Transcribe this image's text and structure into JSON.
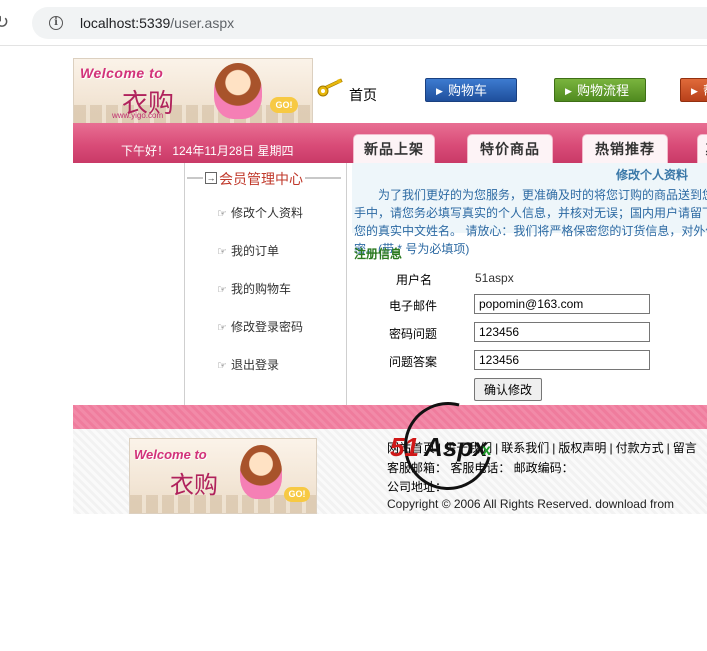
{
  "browser": {
    "url_host": "localhost:5339",
    "url_path": "/user.aspx"
  },
  "header": {
    "logo_welcome": "Welcome to",
    "logo_brand": "衣购",
    "logo_url": "www.yigo.com",
    "logo_go": "GO!",
    "home_label": "首页",
    "nav": {
      "cart": "购物车",
      "flow": "购物流程",
      "more": "帮"
    },
    "greeting": "下午好！ 124年11月28日 星期四",
    "tabs": [
      "新品上架",
      "特价商品",
      "热销推荐",
      "其"
    ]
  },
  "sidebar": {
    "title": "会员管理中心",
    "items": [
      "修改个人资料",
      "我的订单",
      "我的购物车",
      "修改登录密码",
      "退出登录"
    ]
  },
  "main": {
    "heading": "修改个人资料",
    "notice": "为了我们更好的为您服务，更准确及时的将您订购的商品送到您手中，请您务必填写真实的个人信息，并核对无误；国内用户请留下您的真实中文姓名。 请放心：我们将严格保密您的订货信息，对外保密。(带 * 号为必填项)",
    "reg_title": "注册信息",
    "form": {
      "username_label": "用户名",
      "username_value": "51aspx",
      "email_label": "电子邮件",
      "email_value": "popomin@163.com",
      "question_label": "密码问题",
      "question_value": "123456",
      "answer_label": "问题答案",
      "answer_value": "123456",
      "submit_label": "确认修改"
    }
  },
  "footer": {
    "links": [
      "网站首页",
      "关于我们",
      "联系我们",
      "版权声明",
      "付款方式",
      "留言"
    ],
    "service_line": "客服邮箱： 客服电话： 邮政编码：",
    "address_line": "公司地址：",
    "copyright": "Copyright © 2006 All Rights Reserved. download from"
  },
  "watermark": {
    "text_51": "51",
    "text_aspx": "Aspx"
  },
  "colors": {
    "pink_bar": "#d94c78",
    "blue_button": "#1f4f9c",
    "green_button": "#4f8a1f",
    "heading_blue": "#3a78a8",
    "reg_green": "#2b7a1f"
  }
}
